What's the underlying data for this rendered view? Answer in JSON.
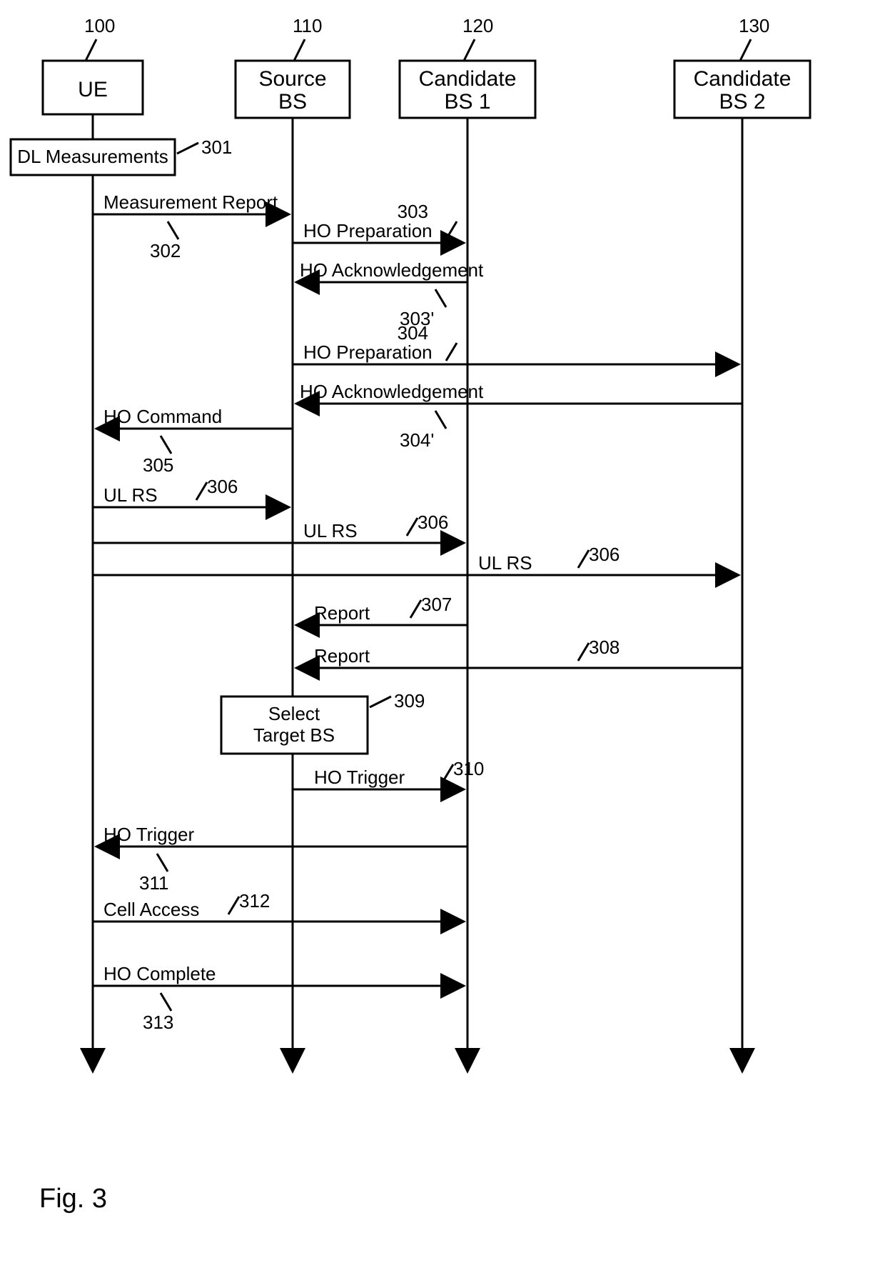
{
  "figure_label": "Fig. 3",
  "actors": {
    "ue": {
      "label": "UE",
      "ref": "100"
    },
    "src": {
      "label": "Source\nBS",
      "ref": "110"
    },
    "cand1": {
      "label": "Candidate\nBS 1",
      "ref": "120"
    },
    "cand2": {
      "label": "Candidate\nBS 2",
      "ref": "130"
    }
  },
  "nodes": {
    "dl_meas": {
      "label": "DL Measurements",
      "ref": "301"
    },
    "select_bs": {
      "label": "Select\nTarget BS",
      "ref": "309"
    }
  },
  "messages": {
    "meas_report": {
      "label": "Measurement Report",
      "ref": "302"
    },
    "ho_prep_1": {
      "label": "HO Preparation",
      "ref": "303"
    },
    "ho_ack_1": {
      "label": "HO Acknowledgement",
      "ref": "303'"
    },
    "ho_prep_2": {
      "label": "HO Preparation",
      "ref": "304"
    },
    "ho_ack_2": {
      "label": "HO Acknowledgement",
      "ref": "304'"
    },
    "ho_cmd": {
      "label": "HO Command",
      "ref": "305"
    },
    "ul_rs_a": {
      "label": "UL RS",
      "ref": "306"
    },
    "ul_rs_b": {
      "label": "UL RS",
      "ref": "306"
    },
    "ul_rs_c": {
      "label": "UL RS",
      "ref": "306"
    },
    "report_1": {
      "label": "Report",
      "ref": "307"
    },
    "report_2": {
      "label": "Report",
      "ref": "308"
    },
    "ho_trigger_bs": {
      "label": "HO Trigger",
      "ref": "310"
    },
    "ho_trigger_ue": {
      "label": "HO Trigger",
      "ref": "311"
    },
    "cell_access": {
      "label": "Cell Access",
      "ref": "312"
    },
    "ho_complete": {
      "label": "HO Complete",
      "ref": "313"
    }
  }
}
